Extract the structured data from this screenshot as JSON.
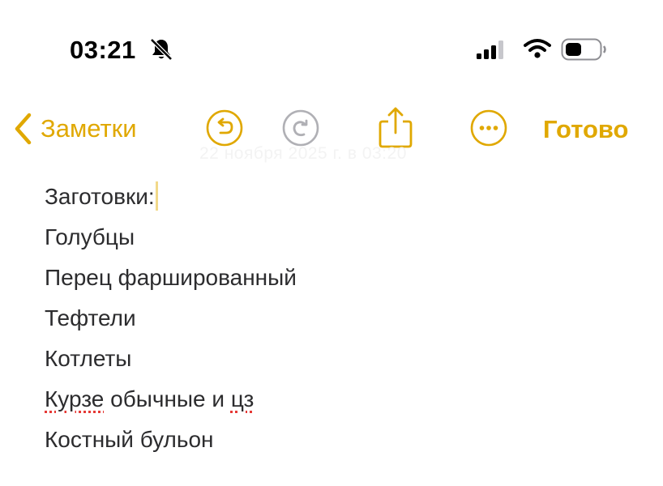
{
  "status_bar": {
    "time": "03:21",
    "icons": [
      "bell-slash-icon",
      "cellular-signal-icon",
      "wifi-icon",
      "battery-icon"
    ]
  },
  "toolbar": {
    "back_label": "Заметки",
    "buttons": [
      "undo-icon",
      "redo-icon",
      "share-icon",
      "more-icon"
    ],
    "done_label": "Готово",
    "accent_color": "#e0a800"
  },
  "note": {
    "date_ghost": "22 ноября 2025 г. в 03:20",
    "lines": [
      {
        "text": "Заготовки:"
      },
      {
        "text": "Голубцы"
      },
      {
        "text": "Перец фаршированный"
      },
      {
        "text": "Тефтели"
      },
      {
        "text": "Котлеты"
      },
      {
        "prefix": "Курзе",
        "middle": " обычные и ",
        "suffix": "цз"
      },
      {
        "text": "Костный бульон"
      }
    ]
  }
}
